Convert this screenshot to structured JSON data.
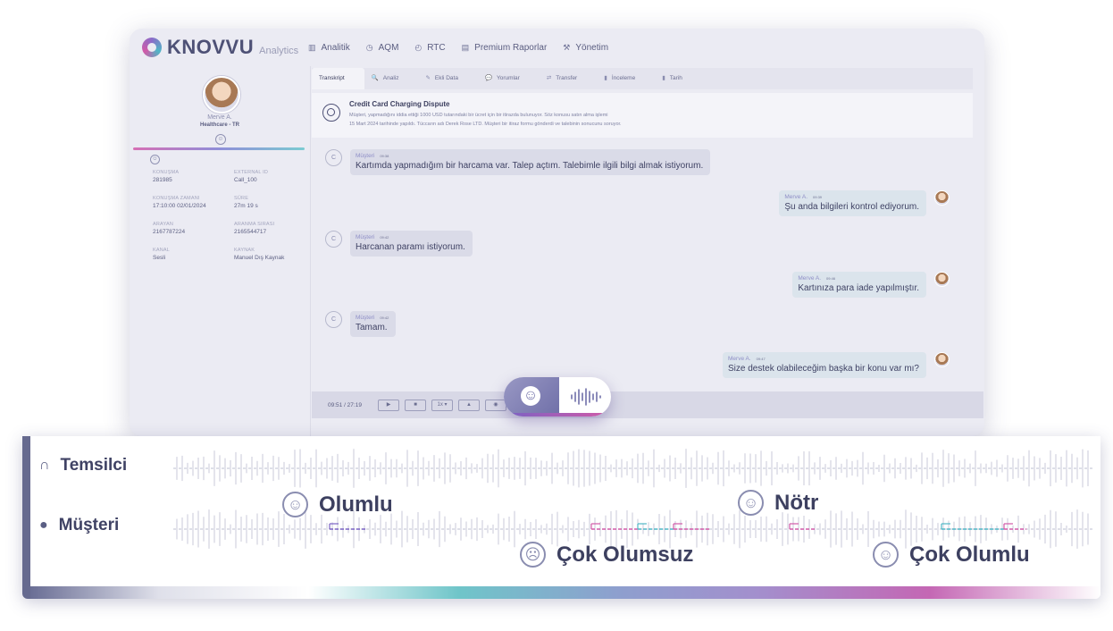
{
  "app": {
    "logo_text": "KNOVVU",
    "logo_sub": "Analytics",
    "nav": [
      {
        "icon": "chart-icon",
        "glyph": "▥",
        "label": "Analitik"
      },
      {
        "icon": "clock-icon",
        "glyph": "◷",
        "label": "AQM"
      },
      {
        "icon": "timer-icon",
        "glyph": "◴",
        "label": "RTC"
      },
      {
        "icon": "report-icon",
        "glyph": "▤",
        "label": "Premium Raporlar"
      },
      {
        "icon": "tools-icon",
        "glyph": "⚒",
        "label": "Yönetim"
      }
    ]
  },
  "agent": {
    "name": "Merve A.",
    "department": "Healthcare - TR"
  },
  "fields": [
    {
      "label": "Konuşma",
      "value": "281985"
    },
    {
      "label": "External ID",
      "value": "Call_100"
    },
    {
      "label": "Konuşma Zamanı",
      "value": "17:10:00   02/01/2024"
    },
    {
      "label": "Süre",
      "value": "27m 19 s"
    },
    {
      "label": "Arayan",
      "value": "2167787224"
    },
    {
      "label": "Aranma Sırası",
      "value": "2165544717"
    },
    {
      "label": "Kanal",
      "value": "Sesli"
    },
    {
      "label": "Kaynak",
      "value": "Manuel Dış Kaynak"
    }
  ],
  "tabs": [
    {
      "label": "Transkript",
      "icon": ""
    },
    {
      "label": "Analiz",
      "icon": "🔍"
    },
    {
      "label": "Ekli Data",
      "icon": "✎"
    },
    {
      "label": "Yorumlar",
      "icon": "💬"
    },
    {
      "label": "Transfer",
      "icon": "⇄"
    },
    {
      "label": "İnceleme",
      "icon": "▮"
    },
    {
      "label": "Tarih",
      "icon": "▮"
    }
  ],
  "summary": {
    "title": "Credit Card Charging Dispute",
    "line1": "Müşteri, yapmadığını iddia ettiği 1000 USD tutarındaki bir ücret için bir itirazda bulunuyor. Söz konusu satın alma işlemi",
    "line2": "15 Mart 2024 tarihinde yapıldı. Tüccarın adı Derek Rose LTD. Müşteri bir itiraz formu gönderdi ve talebinin sonucunu soruyor."
  },
  "messages": [
    {
      "side": "customer",
      "name": "Müşteri",
      "time": "09:38",
      "text": "Kartımda yapmadığım bir harcama var. Talep açtım. Talebimle ilgili bilgi almak istiyorum."
    },
    {
      "side": "agent",
      "name": "Merve A.",
      "time": "09:39",
      "text": "Şu anda bilgileri kontrol ediyorum."
    },
    {
      "side": "customer",
      "name": "Müşteri",
      "time": "09:42",
      "text": "Harcanan paramı istiyorum."
    },
    {
      "side": "agent",
      "name": "Merve A.",
      "time": "09:46",
      "text": "Kartınıza para iade yapılmıştır."
    },
    {
      "side": "customer",
      "name": "Müşteri",
      "time": "09:42",
      "text": "Tamam."
    },
    {
      "side": "agent",
      "name": "Merve A.",
      "time": "09:47",
      "text": "Size destek olabileceğim başka bir konu var mı?"
    }
  ],
  "player": {
    "time": "09:51 / 27:19",
    "buttons": [
      "▶",
      "■",
      "1x ▾",
      "▲",
      "◉"
    ]
  },
  "waveform": {
    "agent_label": "Temsilci",
    "customer_label": "Müşteri",
    "colors": {
      "wave": "#c9cad8",
      "dash": "#a9abc3",
      "pink": "#d15aa8",
      "teal": "#4fb6c6",
      "purple": "#7a62c4"
    },
    "sentiments": [
      {
        "label": "Olumlu",
        "face": "☺"
      },
      {
        "label": "Nötr",
        "face": "☺"
      },
      {
        "label": "Çok Olumsuz",
        "face": "☹"
      },
      {
        "label": "Çok Olumlu",
        "face": "☺"
      }
    ]
  }
}
